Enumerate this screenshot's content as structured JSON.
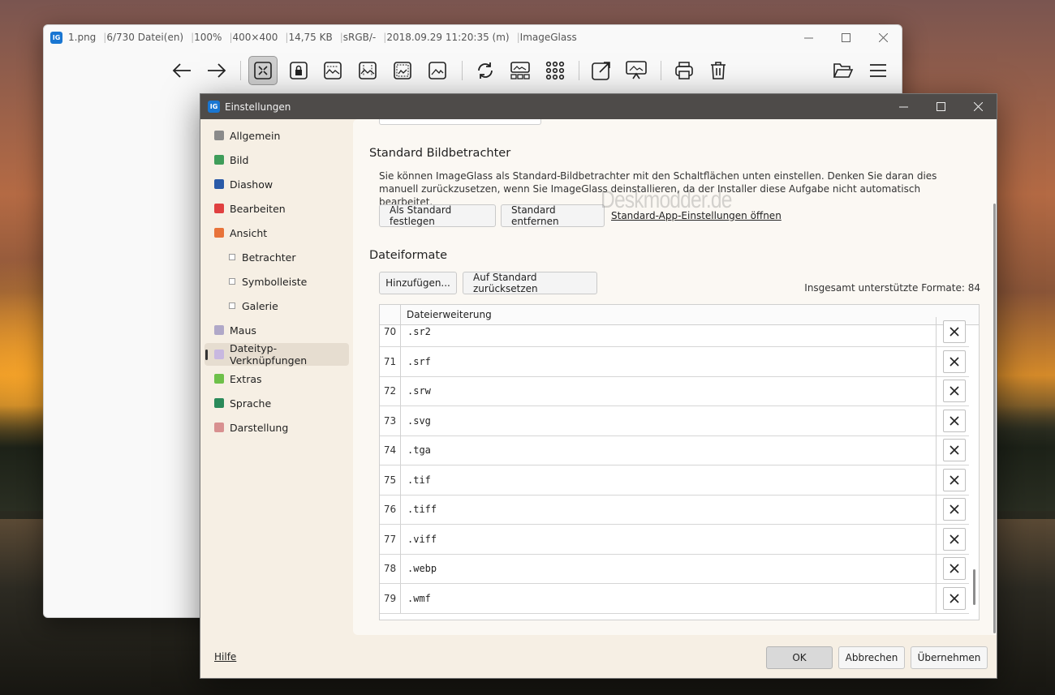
{
  "main_window": {
    "filename": "1.png",
    "index": "6/730 Datei(en)",
    "zoom": "100%",
    "dimensions": "400×400",
    "filesize": "14,75 KB",
    "colorspace": "sRGB/-",
    "datetime": "2018.09.29 11:20:35 (m)",
    "app": "ImageGlass"
  },
  "settings": {
    "title": "Einstellungen",
    "nav": [
      {
        "label": "Allgemein",
        "icon": "gear-icon",
        "color": "#8a8a8a"
      },
      {
        "label": "Bild",
        "icon": "image-icon",
        "color": "#3f9d5a"
      },
      {
        "label": "Diashow",
        "icon": "slideshow-icon",
        "color": "#2a5aa8"
      },
      {
        "label": "Bearbeiten",
        "icon": "pen-icon",
        "color": "#e04040"
      },
      {
        "label": "Ansicht",
        "icon": "layout-icon",
        "color": "#e8733a"
      },
      {
        "label": "Betrachter",
        "sub": true
      },
      {
        "label": "Symbolleiste",
        "sub": true
      },
      {
        "label": "Galerie",
        "sub": true
      },
      {
        "label": "Maus",
        "icon": "mouse-icon",
        "color": "#b0a8c8"
      },
      {
        "label": "Dateityp-Verknüpfungen",
        "icon": "file-icon",
        "color": "#c8b8e0",
        "active": true
      },
      {
        "label": "Extras",
        "icon": "puzzle-icon",
        "color": "#6ec04a"
      },
      {
        "label": "Sprache",
        "icon": "globe-icon",
        "color": "#2a8a5a"
      },
      {
        "label": "Darstellung",
        "icon": "palette-icon",
        "color": "#d89090"
      }
    ],
    "default_viewer": {
      "heading": "Standard Bildbetrachter",
      "description": "Sie können ImageGlass als Standard-Bildbetrachter mit den Schaltflächen unten einstellen. Denken Sie daran dies manuell zurückzusetzen, wenn Sie ImageGlass deinstallieren, da der Installer diese Aufgabe nicht automatisch bearbeitet.",
      "set_default_label": "Als Standard festlegen",
      "remove_default_label": "Standard entfernen",
      "open_app_settings_label": "Standard-App-Einstellungen öffnen"
    },
    "file_formats": {
      "heading": "Dateiformate",
      "add_label": "Hinzufügen...",
      "reset_label": "Auf Standard zurücksetzen",
      "total_label": "Insgesamt unterstützte Formate: 84",
      "column_header": "Dateierweiterung",
      "rows": [
        {
          "num": "70",
          "ext": ".sr2"
        },
        {
          "num": "71",
          "ext": ".srf"
        },
        {
          "num": "72",
          "ext": ".srw"
        },
        {
          "num": "73",
          "ext": ".svg"
        },
        {
          "num": "74",
          "ext": ".tga"
        },
        {
          "num": "75",
          "ext": ".tif"
        },
        {
          "num": "76",
          "ext": ".tiff"
        },
        {
          "num": "77",
          "ext": ".viff"
        },
        {
          "num": "78",
          "ext": ".webp"
        },
        {
          "num": "79",
          "ext": ".wmf"
        }
      ]
    },
    "watermark": "Deskmodder.de",
    "footer": {
      "help_label": "Hilfe",
      "ok_label": "OK",
      "cancel_label": "Abbrechen",
      "apply_label": "Übernehmen"
    }
  }
}
